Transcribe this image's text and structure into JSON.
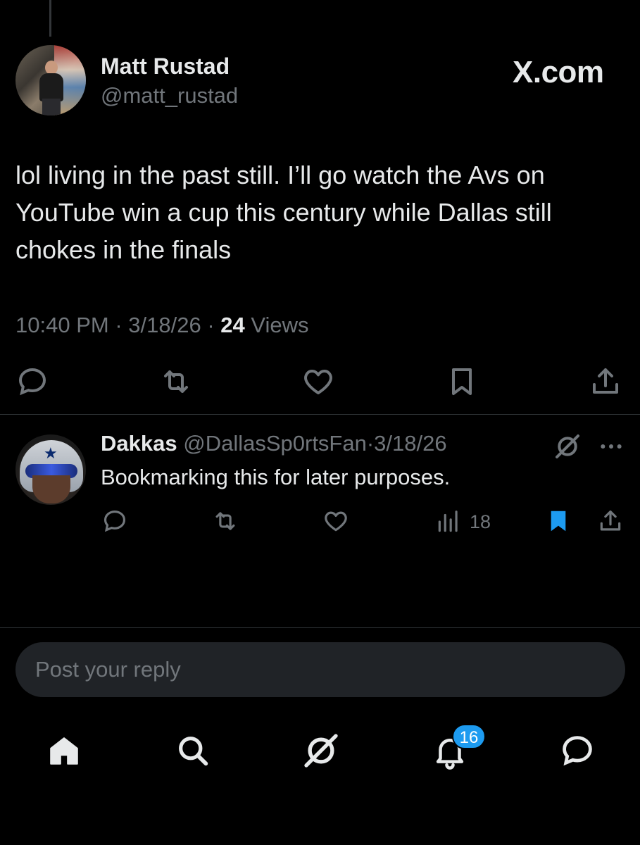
{
  "author": {
    "name": "Matt Rustad",
    "handle": "@matt_rustad"
  },
  "brand": "X.com",
  "post": {
    "text": "lol living in the past still. I’ll go watch the Avs on YouTube win a cup this century while Dallas still chokes in the finals",
    "time": "10:40 PM",
    "date": "3/18/26",
    "views_count": "24",
    "views_label": "Views",
    "separator": "·"
  },
  "post_actions": [
    "reply-icon",
    "repost-icon",
    "like-icon",
    "bookmark-icon",
    "share-icon"
  ],
  "reply": {
    "name": "Dakkas",
    "handle": "@DallasSp0rtsFan",
    "separator": "·",
    "date": "3/18/26",
    "text": "Bookmarking this for later purposes.",
    "views_count": "18",
    "bookmarked": true,
    "icons": [
      "grok-icon",
      "more-icon",
      "reply-icon",
      "repost-icon",
      "like-icon",
      "analytics-icon",
      "bookmark-filled-icon",
      "share-icon"
    ]
  },
  "reply_box": {
    "placeholder": "Post your reply"
  },
  "bottom_nav": {
    "items": [
      "home-icon",
      "search-icon",
      "grok-icon",
      "notifications-icon",
      "messages-icon"
    ],
    "notifications_badge": "16"
  },
  "colors": {
    "background": "#000000",
    "text": "#e7e9ea",
    "secondary_text": "#71767b",
    "divider": "#2f3336",
    "accent": "#1d9bf0"
  }
}
